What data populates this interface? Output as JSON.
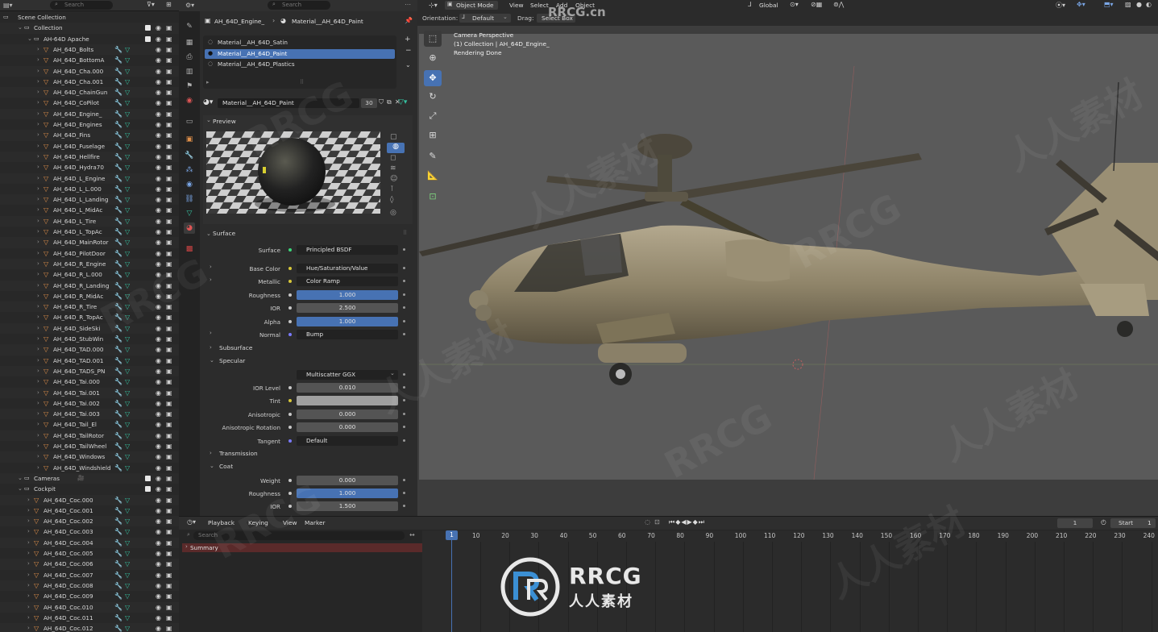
{
  "outliner": {
    "search_placeholder": "Search",
    "scene_collection": "Scene Collection",
    "collection": "Collection",
    "apache": "AH-64D Apache",
    "apache_items": [
      "AH_64D_Bolts",
      "AH_64D_BottomA",
      "AH_64D_Cha.000",
      "AH_64D_Cha.001",
      "AH_64D_ChainGun",
      "AH_64D_CoPilot",
      "AH_64D_Engine_",
      "AH_64D_Engines",
      "AH_64D_Fins",
      "AH_64D_Fuselage",
      "AH_64D_Hellfire",
      "AH_64D_Hydra70",
      "AH_64D_L_Engine",
      "AH_64D_L_L.000",
      "AH_64D_L_Landing",
      "AH_64D_L_MidAc",
      "AH_64D_L_Tire",
      "AH_64D_L_TopAc",
      "AH_64D_MainRotor",
      "AH_64D_PilotDoor",
      "AH_64D_R_Engine",
      "AH_64D_R_L.000",
      "AH_64D_R_Landing",
      "AH_64D_R_MidAc",
      "AH_64D_R_Tire",
      "AH_64D_R_TopAc",
      "AH_64D_SideSki",
      "AH_64D_StubWin",
      "AH_64D_TAD.000",
      "AH_64D_TAD.001",
      "AH_64D_TADS_PN",
      "AH_64D_Tai.000",
      "AH_64D_Tai.001",
      "AH_64D_Tai.002",
      "AH_64D_Tai.003",
      "AH_64D_Tail_El",
      "AH_64D_TailRotor",
      "AH_64D_TailWheel",
      "AH_64D_Windows",
      "AH_64D_Windshield"
    ],
    "cameras": "Cameras",
    "cockpit": "Cockpit",
    "cockpit_items": [
      "AH_64D_Coc.000",
      "AH_64D_Coc.001",
      "AH_64D_Coc.002",
      "AH_64D_Coc.003",
      "AH_64D_Coc.004",
      "AH_64D_Coc.005",
      "AH_64D_Coc.006",
      "AH_64D_Coc.007",
      "AH_64D_Coc.008",
      "AH_64D_Coc.009",
      "AH_64D_Coc.010",
      "AH_64D_Coc.011",
      "AH_64D_Coc.012"
    ]
  },
  "properties": {
    "search_placeholder": "Search",
    "breadcrumb_object": "AH_64D_Engine_",
    "breadcrumb_material": "Material__AH_64D_Paint",
    "slots": [
      "Material__AH_64D_Satin",
      "Material__AH_64D_Paint",
      "Material__AH_64D_Plastics"
    ],
    "material_name": "Material__AH_64D_Paint",
    "users": "30",
    "preview": "Preview",
    "surface_section": "Surface",
    "surface_label": "Surface",
    "surface_value": "Principled BSDF",
    "base_color_label": "Base Color",
    "base_color_value": "Hue/Saturation/Value",
    "metallic_label": "Metallic",
    "metallic_value": "Color Ramp",
    "roughness_label": "Roughness",
    "roughness_value": "1.000",
    "ior_label": "IOR",
    "ior_value": "2.500",
    "alpha_label": "Alpha",
    "alpha_value": "1.000",
    "normal_label": "Normal",
    "normal_value": "Bump",
    "subsurface": "Subsurface",
    "specular": "Specular",
    "distribution": "Multiscatter GGX",
    "ior_level_label": "IOR Level",
    "ior_level_value": "0.010",
    "tint_label": "Tint",
    "aniso_label": "Anisotropic",
    "aniso_value": "0.000",
    "aniso_rot_label": "Anisotropic Rotation",
    "aniso_rot_value": "0.000",
    "tangent_label": "Tangent",
    "tangent_value": "Default",
    "transmission": "Transmission",
    "coat": "Coat",
    "weight_label": "Weight",
    "weight_value": "0.000",
    "coat_rough_label": "Roughness",
    "coat_rough_value": "1.000",
    "coat_ior_label": "IOR",
    "coat_ior_value": "1.500"
  },
  "viewport": {
    "mode": "Object Mode",
    "menu": [
      "View",
      "Select",
      "Add",
      "Object"
    ],
    "orientation_label": "Orientation:",
    "orientation_value": "Default",
    "drag_label": "Drag:",
    "drag_value": "Select Box",
    "transform": "Global",
    "overlay_line1": "Camera Perspective",
    "overlay_line2": "(1) Collection | AH_64D_Engine_",
    "overlay_line3": "Rendering Done",
    "watermark": "RRCG.cn"
  },
  "timeline": {
    "menu": [
      "Playback",
      "Keying",
      "View",
      "Marker"
    ],
    "search_placeholder": "Search",
    "summary": "Summary",
    "current_frame": "1",
    "start_label": "Start",
    "start_value": "1",
    "frames": [
      "10",
      "20",
      "30",
      "40",
      "50",
      "60",
      "70",
      "80",
      "90",
      "100",
      "110",
      "120",
      "130",
      "140",
      "150",
      "160",
      "170",
      "180",
      "190",
      "200",
      "210",
      "220",
      "230",
      "240"
    ]
  },
  "logo": {
    "main": "RRCG",
    "sub": "人人素材"
  }
}
